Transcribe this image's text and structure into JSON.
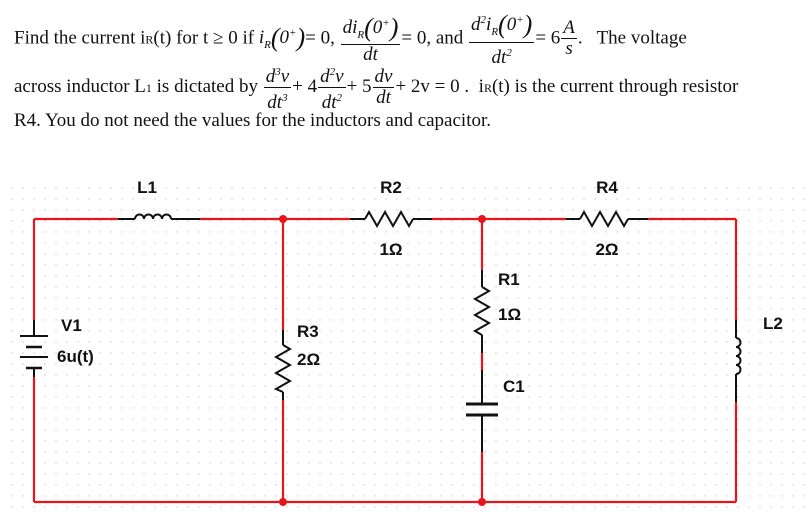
{
  "problem": {
    "line1": {
      "intro": "Find the current i",
      "intro_sub": "R",
      "intro_rest": "(t) for t ≥ 0 if",
      "ic1_var": "i",
      "ic1_sub": "R",
      "ic1_arg": "0",
      "ic1_sup": "+",
      "ic1_eq": "= 0,",
      "ic2_num_pre": "di",
      "ic2_num_sub": "R",
      "ic2_num_arg": "0",
      "ic2_num_sup": "+",
      "ic2_den": "dt",
      "ic2_eq": "= 0, and",
      "ic3_num_pre": "d",
      "ic3_num_sup1": "2",
      "ic3_num_var": "i",
      "ic3_num_sub": "R",
      "ic3_num_arg": "0",
      "ic3_num_sup": "+",
      "ic3_den": "dt",
      "ic3_den_sup": "2",
      "ic3_eq": "= 6",
      "unit_num": "A",
      "unit_den": "s",
      "tail": ".   The voltage"
    },
    "line2": {
      "intro": "across inductor L",
      "intro_sub": "1",
      "intro_rest": "is dictated by",
      "t1_num": "d",
      "t1_num_sup": "3",
      "t1_num_var": "v",
      "t1_den": "dt",
      "t1_den_sup": "3",
      "t2_coef": "+ 4",
      "t2_num": "d",
      "t2_num_sup": "2",
      "t2_num_var": "v",
      "t2_den": "dt",
      "t2_den_sup": "2",
      "t3_coef": "+ 5",
      "t3_num": "dv",
      "t3_den": "dt",
      "t4": "+ 2v = 0 .",
      "tail_pre": "i",
      "tail_sub": "R",
      "tail_rest": "(t) is the current through resistor"
    },
    "line3": "R4.  You do not need the values for the inductors and capacitor."
  },
  "schematic": {
    "wire_color": "#e8141c",
    "component_color": "#111111",
    "components": {
      "L1": {
        "name": "L1",
        "value": ""
      },
      "R2": {
        "name": "R2",
        "value": "1Ω"
      },
      "R4": {
        "name": "R4",
        "value": "2Ω"
      },
      "R1": {
        "name": "R1",
        "value": "1Ω"
      },
      "R3": {
        "name": "R3",
        "value": "2Ω"
      },
      "C1": {
        "name": "C1",
        "value": ""
      },
      "V1": {
        "name": "V1",
        "value": "6u(t)"
      },
      "L2": {
        "name": "L2",
        "value": ""
      }
    }
  }
}
